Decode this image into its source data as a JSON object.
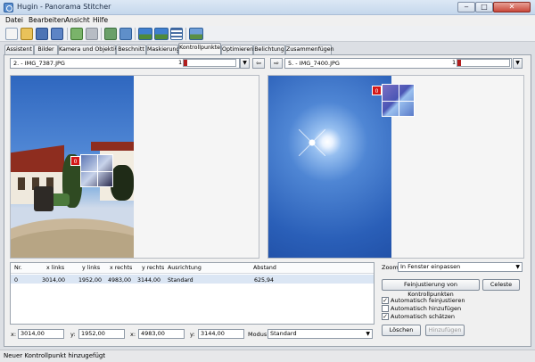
{
  "window": {
    "title": "Hugin - Panorama Stitcher",
    "min": "‒",
    "max": "□",
    "close": "✕"
  },
  "menu": [
    "Datei",
    "Bearbeiten",
    "Ansicht",
    "Hilfe"
  ],
  "toolbar": [
    "new-project-icon",
    "open-icon",
    "save-icon",
    "save-as-icon",
    "undo-icon",
    "redo-icon",
    "add-images-icon",
    "align-icon",
    "preview-icon",
    "fast-preview-icon",
    "image-list-icon",
    "gl-preview-icon"
  ],
  "tabs": [
    "Assistent",
    "Bilder",
    "Kamera und Objektiv",
    "Beschnitt",
    "Maskierung",
    "Kontrollpunkte",
    "Optimieren",
    "Belichtung",
    "Zusammenfügen"
  ],
  "active_tab": 5,
  "left_image": {
    "label": "2. - IMG_7387.JPG",
    "cp_count": "1",
    "marker": "0"
  },
  "right_image": {
    "label": "5. - IMG_7400.JPG",
    "cp_count": "1",
    "marker": "0"
  },
  "swap_left": "⇦",
  "swap_right": "⇨",
  "table": {
    "headers": [
      "Nr.",
      "x links",
      "y links",
      "x rechts",
      "y rechts",
      "Ausrichtung",
      "Abstand"
    ],
    "rows": [
      [
        "0",
        "3014,00",
        "1952,00",
        "4983,00",
        "3144,00",
        "Standard",
        "625,94"
      ]
    ]
  },
  "coords": {
    "x_label": "x:",
    "y_label": "y:",
    "x_left": "3014,00",
    "y_left": "1952,00",
    "x_right": "4983,00",
    "y_right": "3144,00",
    "mode_label": "Modus:",
    "mode_value": "Standard"
  },
  "zoom": {
    "label": "Zoom:",
    "value": "In Fenster einpassen"
  },
  "buttons": {
    "fine_tune": "Feinjustierung von Kontrollpunkten",
    "celeste": "Celeste",
    "delete": "Löschen",
    "add": "Hinzufügen"
  },
  "checks": [
    {
      "label": "Automatisch feinjustieren",
      "checked": true
    },
    {
      "label": "Automatisch hinzufügen",
      "checked": false
    },
    {
      "label": "Automatisch schätzen",
      "checked": true
    }
  ],
  "status": "Neuer Kontrollpunkt hinzugefügt",
  "colors": {
    "accent": "#b11e1e",
    "title_bar": "#c5d7ec"
  }
}
